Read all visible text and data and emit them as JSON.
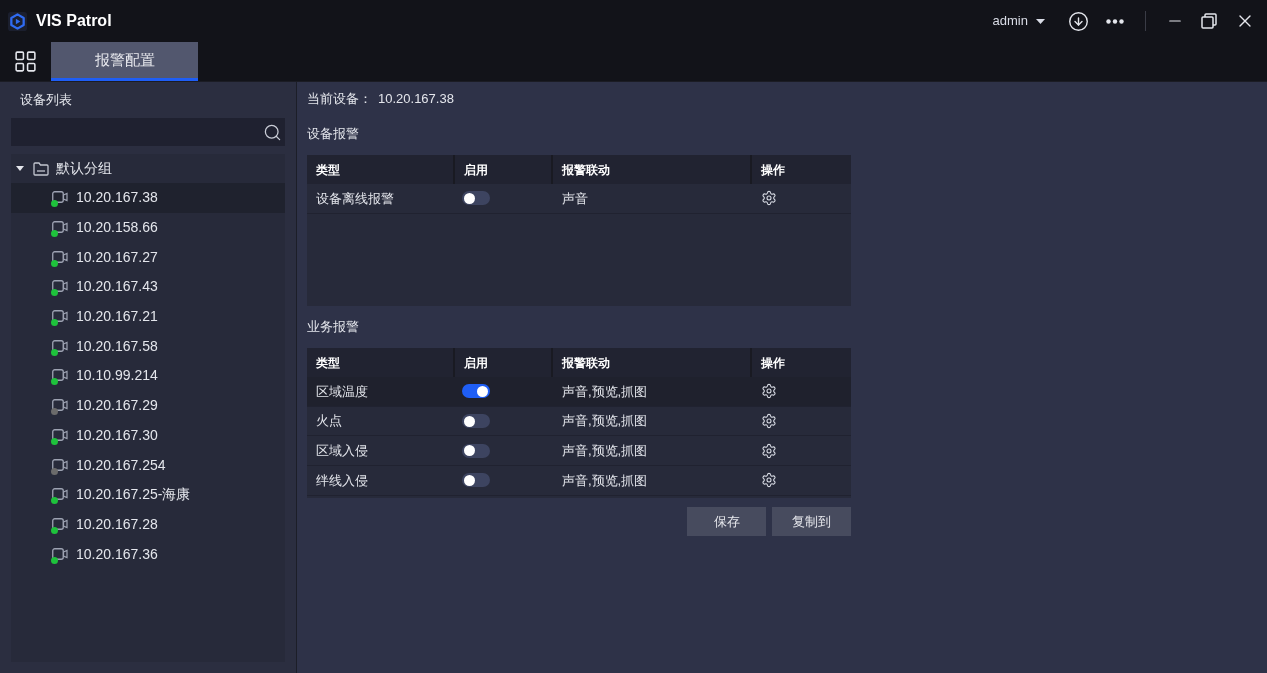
{
  "app": {
    "title": "VIS Patrol",
    "user": "admin"
  },
  "tabs": [
    {
      "label": "报警配置",
      "selected": true
    }
  ],
  "sidebar": {
    "title": "设备列表",
    "tree": [
      {
        "label": "默认分组",
        "expanded": true,
        "children": [
          {
            "label": "10.20.167.38",
            "color": "#1ec23c",
            "selected": true
          },
          {
            "label": "10.20.158.66",
            "color": "#1ec23c",
            "selected": false
          },
          {
            "label": "10.20.167.27",
            "color": "#1ec23c",
            "selected": false
          },
          {
            "label": "10.20.167.43",
            "color": "#1ec23c",
            "selected": false
          },
          {
            "label": "10.20.167.21",
            "color": "#1ec23c",
            "selected": false
          },
          {
            "label": "10.20.167.58",
            "color": "#1ec23c",
            "selected": false
          },
          {
            "label": "10.10.99.214",
            "color": "#1ec23c",
            "selected": false
          },
          {
            "label": "10.20.167.29",
            "color": "#6b6b6b",
            "selected": false
          },
          {
            "label": "10.20.167.30",
            "color": "#1ec23c",
            "selected": false
          },
          {
            "label": "10.20.167.254",
            "color": "#6b6b6b",
            "selected": false
          },
          {
            "label": "10.20.167.25-海康",
            "color": "#1ec23c",
            "selected": false
          },
          {
            "label": "10.20.167.28",
            "color": "#1ec23c",
            "selected": false
          },
          {
            "label": "10.20.167.36",
            "color": "#1ec23c",
            "selected": false
          }
        ]
      }
    ]
  },
  "current_device": {
    "label": "当前设备：",
    "value": "10.20.167.38"
  },
  "device_alarms": {
    "title": "设备报警",
    "columns": [
      "类型",
      "启用",
      "报警联动",
      "操作"
    ],
    "rows": [
      {
        "type": "设备离线报警",
        "enabled": false,
        "linkage": "声音",
        "selected": false
      }
    ]
  },
  "business_alarms": {
    "title": "业务报警",
    "columns": [
      "类型",
      "启用",
      "报警联动",
      "操作"
    ],
    "rows": [
      {
        "type": "区域温度",
        "enabled": true,
        "linkage": "声音,预览,抓图",
        "selected": true
      },
      {
        "type": "火点",
        "enabled": false,
        "linkage": "声音,预览,抓图",
        "selected": false
      },
      {
        "type": "区域入侵",
        "enabled": false,
        "linkage": "声音,预览,抓图",
        "selected": false
      },
      {
        "type": "绊线入侵",
        "enabled": false,
        "linkage": "声音,预览,抓图",
        "selected": false
      }
    ]
  },
  "buttons": [
    "保存",
    "复制到"
  ]
}
